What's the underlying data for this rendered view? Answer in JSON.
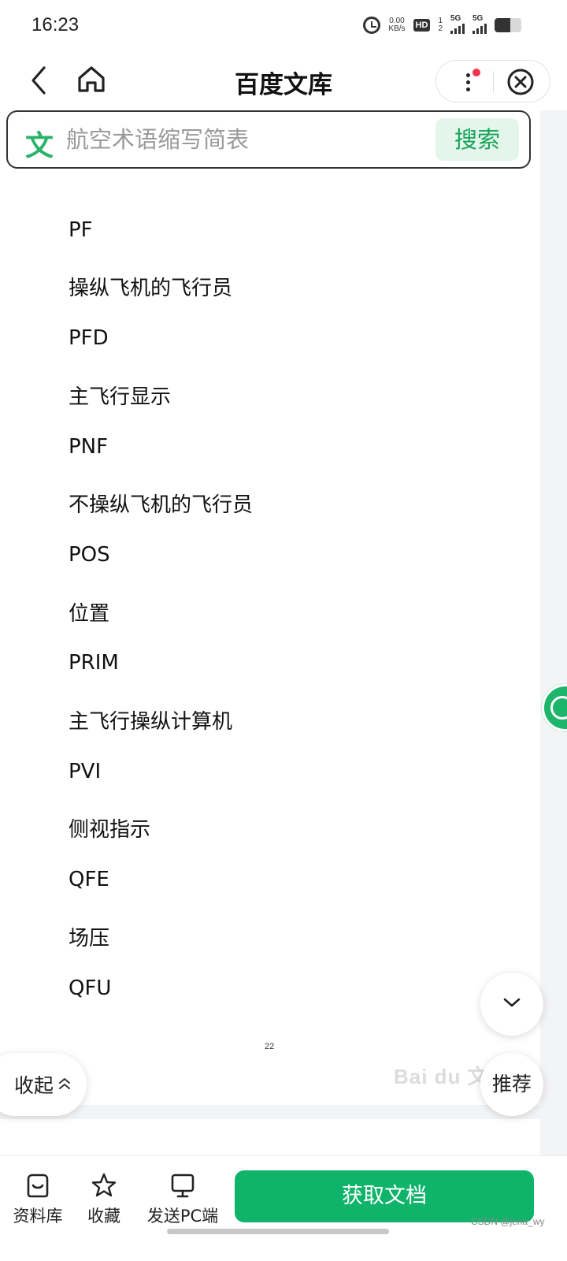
{
  "status_bar": {
    "time": "16:23",
    "net_speed_value": "0.00",
    "net_speed_unit": "KB/s",
    "hd_badge": "HD",
    "sim_slot": "1\n2",
    "signal_1_tag": "5G",
    "signal_2_tag": "5G",
    "battery_level": 0.6
  },
  "header": {
    "title": "百度文库",
    "back_icon": "chevron-left-icon",
    "home_icon": "home-icon",
    "more_icon": "more-vertical-icon",
    "close_icon": "close-circle-icon"
  },
  "search": {
    "logo_char": "文",
    "placeholder": "航空术语缩写简表",
    "button_label": "搜索"
  },
  "document": {
    "terms": [
      "PF",
      "操纵飞机的飞行员",
      "PFD",
      "主飞行显示",
      "PNF",
      "不操纵飞机的飞行员",
      "POS",
      "位置",
      "PRIM",
      "主飞行操纵计算机",
      "PVI",
      "侧视指示",
      "QFE",
      "场压",
      "QFU"
    ],
    "page_number": "22",
    "watermark": "Bai du 文库"
  },
  "floating": {
    "collapse_label": "收起",
    "recommend_label": "推荐"
  },
  "bottom_bar": {
    "library_label": "资料库",
    "favorite_label": "收藏",
    "send_pc_label": "发送PC端",
    "get_doc_label": "获取文档",
    "credit": "CSDN @jena_wy"
  },
  "colors": {
    "accent_green": "#0fb36a",
    "search_btn_bg": "#e4f6ec",
    "badge_red": "#f5324b"
  }
}
